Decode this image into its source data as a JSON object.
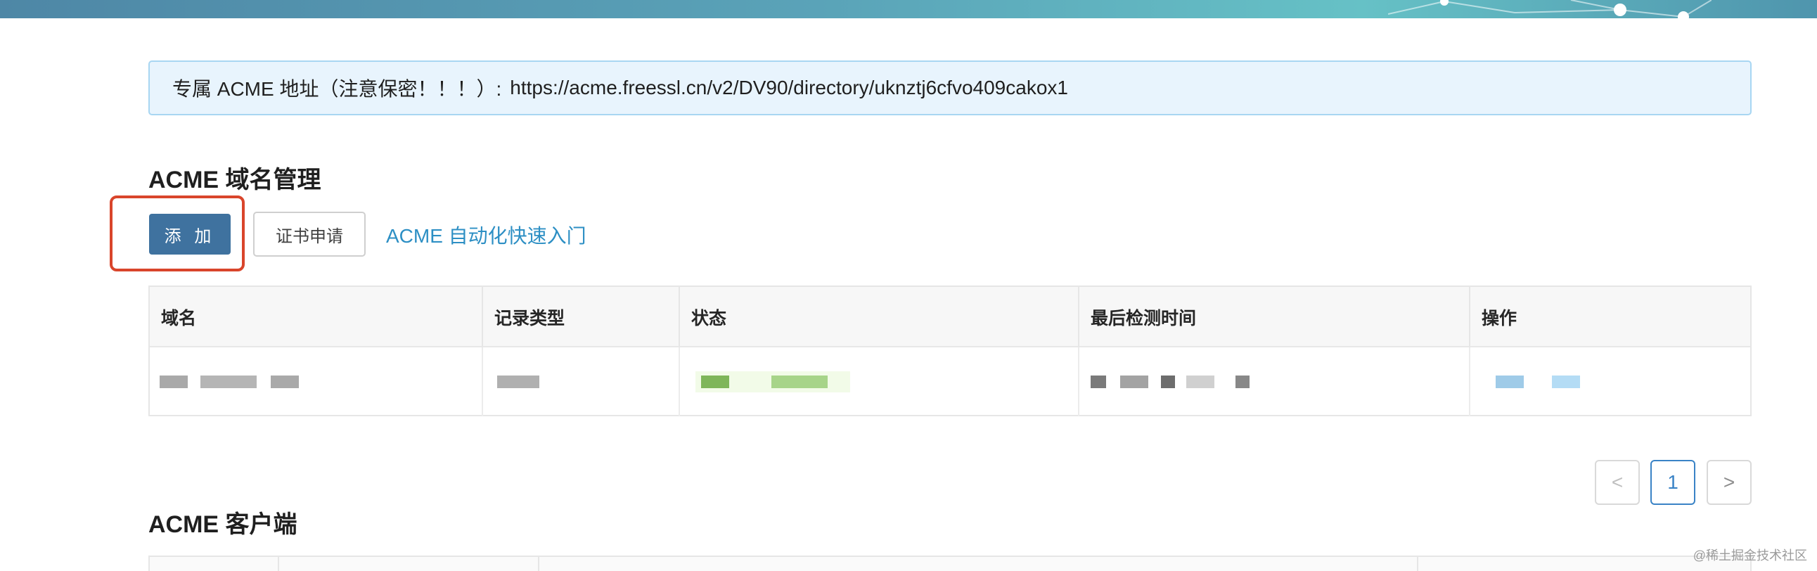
{
  "notice": {
    "label": "专属 ACME 地址（注意保密！！！）:",
    "url": "https://acme.freessl.cn/v2/DV90/directory/uknztj6cfvo409cakox1"
  },
  "domain_section": {
    "title": "ACME 域名管理",
    "add_button": "添 加",
    "apply_button": "证书申请",
    "quickstart_link": "ACME 自动化快速入门"
  },
  "table": {
    "columns": [
      "域名",
      "记录类型",
      "状态",
      "最后检测时间",
      "操作"
    ]
  },
  "pagination": {
    "prev": "<",
    "current": "1",
    "next": ">"
  },
  "client_section": {
    "title": "ACME 客户端"
  },
  "watermark": "@稀土掘金技术社区",
  "colors": {
    "accent_button": "#3f729f",
    "highlight_box": "#d9452b",
    "link": "#2d8fc4",
    "notice_bg": "#e8f4fd"
  }
}
